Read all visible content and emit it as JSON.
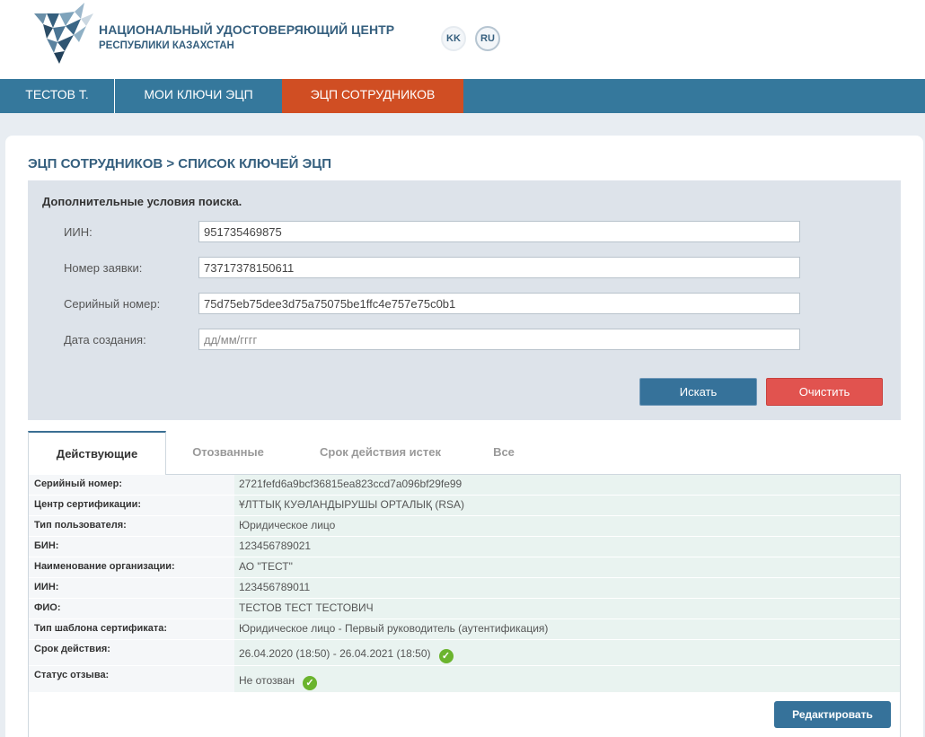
{
  "header": {
    "title": "НАЦИОНАЛЬНЫЙ УДОСТОВЕРЯЮЩИЙ ЦЕНТР",
    "subtitle": "РЕСПУБЛИКИ КАЗАХСТАН",
    "lang_kk": "KK",
    "lang_ru": "RU"
  },
  "nav": {
    "user": "ТЕСТОВ Т.",
    "my_keys": "МОИ КЛЮЧИ ЭЦП",
    "employee_keys": "ЭЦП СОТРУДНИКОВ"
  },
  "page": {
    "title": "ЭЦП СОТРУДНИКОВ > СПИСОК КЛЮЧЕЙ ЭЦП"
  },
  "search": {
    "heading": "Дополнительные условия поиска.",
    "fields": [
      {
        "label": "ИИН:",
        "value": "951735469875",
        "placeholder": ""
      },
      {
        "label": "Номер заявки:",
        "value": "73717378150611",
        "placeholder": ""
      },
      {
        "label": "Серийный номер:",
        "value": "75d75eb75dee3d75a75075be1ffc4e757e75c0b1",
        "placeholder": ""
      },
      {
        "label": "Дата создания:",
        "value": "",
        "placeholder": "дд/мм/гггг"
      }
    ],
    "search_button": "Искать",
    "clear_button": "Очистить"
  },
  "tabs": [
    "Действующие",
    "Отозванные",
    "Срок действия истек",
    "Все"
  ],
  "certificate": {
    "rows": [
      {
        "key": "Серийный номер:",
        "value": "2721fefd6a9bcf36815ea823ccd7a096bf29fe99"
      },
      {
        "key": "Центр сертификации:",
        "value": "ҰЛТТЫҚ КУӘЛАНДЫРУШЫ ОРТАЛЫҚ (RSA)"
      },
      {
        "key": "Тип пользователя:",
        "value": "Юридическое лицо"
      },
      {
        "key": "БИН:",
        "value": "123456789021"
      },
      {
        "key": "Наименование организации:",
        "value": "АО \"ТЕСТ\""
      },
      {
        "key": "ИИН:",
        "value": "123456789011"
      },
      {
        "key": "ФИО:",
        "value": "ТЕСТОВ ТЕСТ ТЕСТОВИЧ"
      },
      {
        "key": "Тип шаблона сертификата:",
        "value": "Юридическое лицо - Первый руководитель (аутентификация)"
      },
      {
        "key": "Срок действия:",
        "value": "26.04.2020 (18:50) - 26.04.2021 (18:50)"
      },
      {
        "key": "Статус отзыва:",
        "value": "Не отозван"
      }
    ],
    "valid_icon": "check-circle-icon",
    "edit_button": "Редактировать"
  },
  "colors": {
    "brand": "#355f7e",
    "nav_bg": "#35789c",
    "nav_active": "#d04e23",
    "primary_button": "#36729a",
    "danger_button": "#e1534f",
    "success": "#6bb42e"
  }
}
